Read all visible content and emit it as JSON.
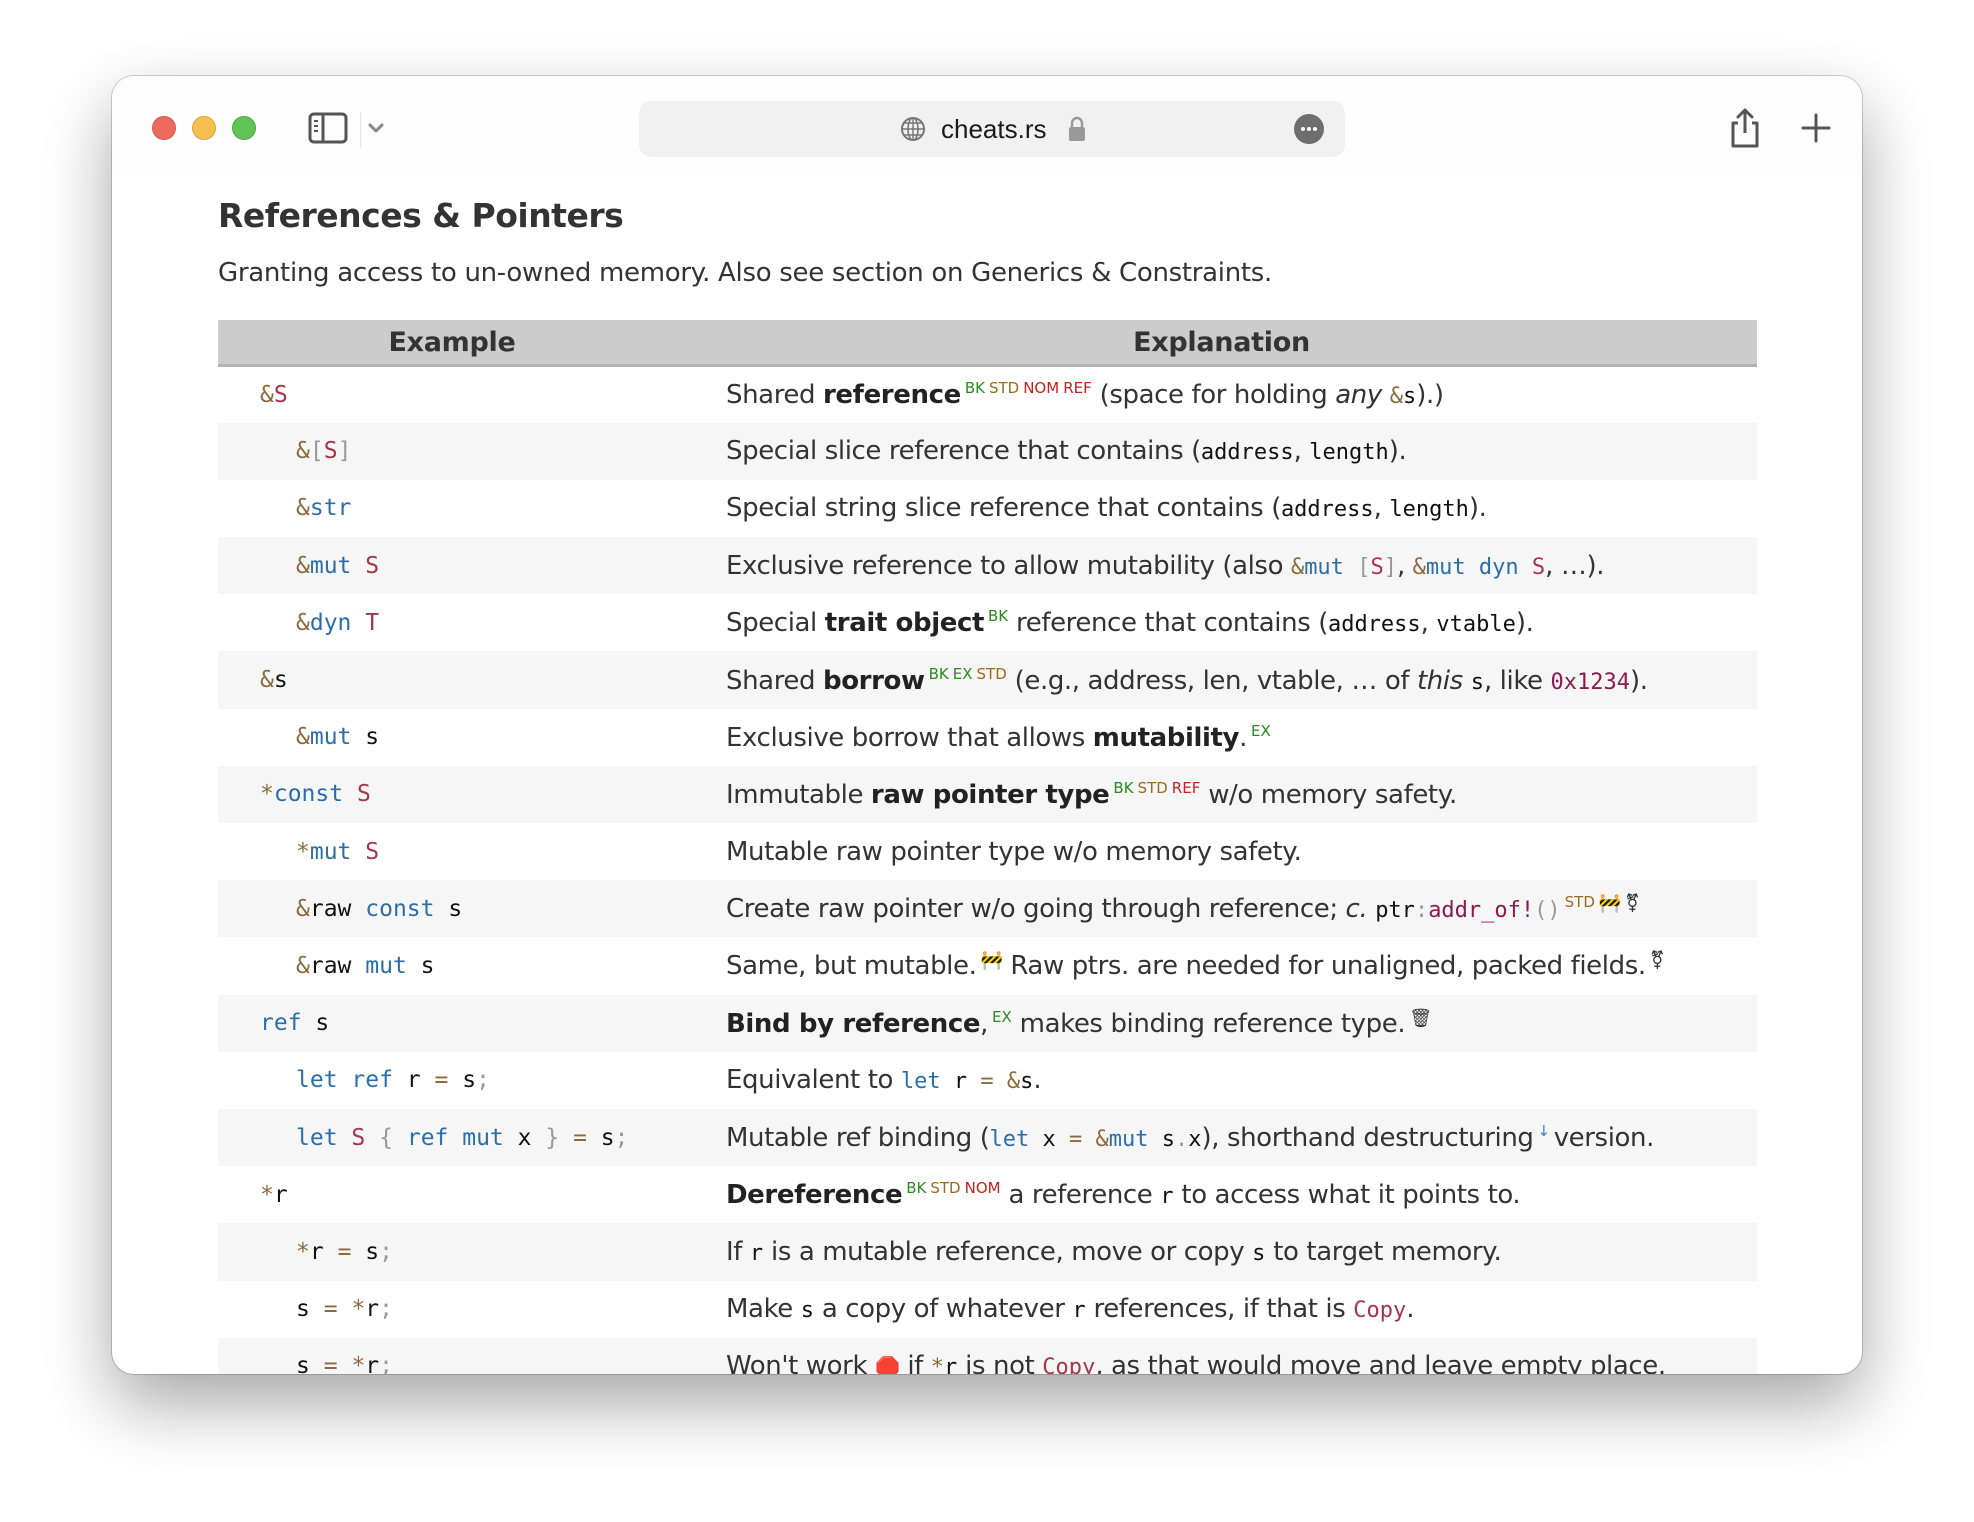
{
  "browser": {
    "url": "cheats.rs",
    "icons": {
      "close": "close-light",
      "minimize": "minimize-light",
      "zoom": "zoom-light",
      "sidebar": "sidebar-icon",
      "chevron": "chevron-down-icon",
      "globe": "globe-icon",
      "lock": "lock-icon",
      "more": "more-icon",
      "share": "share-icon",
      "new_tab": "plus-icon"
    },
    "colors": {
      "close": "#ec6a5e",
      "minimize": "#f4bf4f",
      "zoom": "#61c554"
    }
  },
  "page": {
    "title": "References & Pointers",
    "subtitle": "Granting access to un-owned memory. Also see section on Generics & Constraints."
  },
  "table": {
    "headers": {
      "example": "Example",
      "explanation": "Explanation"
    },
    "rows": [
      {
        "example": [
          [
            "amp",
            "&"
          ],
          [
            "ty",
            "S"
          ]
        ],
        "indent": 0,
        "explanation": [
          [
            "t",
            "Shared "
          ],
          [
            "b",
            "reference"
          ],
          [
            "bk",
            "BK"
          ],
          [
            "std",
            "STD"
          ],
          [
            "nom",
            "NOM"
          ],
          [
            "ref",
            "REF"
          ],
          [
            "t",
            " (space for holding "
          ],
          [
            "i",
            "any"
          ],
          [
            "t",
            " "
          ],
          [
            "c_amp",
            "&"
          ],
          [
            "c_id",
            "s"
          ],
          [
            "t",
            ").)"
          ]
        ]
      },
      {
        "example": [
          [
            "amp",
            "&"
          ],
          [
            "pu",
            "["
          ],
          [
            "ty",
            "S"
          ],
          [
            "pu",
            "]"
          ]
        ],
        "indent": 1,
        "explanation": [
          [
            "t",
            "Special slice reference that contains ("
          ],
          [
            "c_id",
            "address"
          ],
          [
            "t",
            ", "
          ],
          [
            "c_id",
            "length"
          ],
          [
            "t",
            ")."
          ]
        ]
      },
      {
        "example": [
          [
            "amp",
            "&"
          ],
          [
            "kw",
            "str"
          ]
        ],
        "indent": 1,
        "explanation": [
          [
            "t",
            "Special string slice reference that contains ("
          ],
          [
            "c_id",
            "address"
          ],
          [
            "t",
            ", "
          ],
          [
            "c_id",
            "length"
          ],
          [
            "t",
            ")."
          ]
        ]
      },
      {
        "example": [
          [
            "amp",
            "&"
          ],
          [
            "kw",
            "mut"
          ],
          [
            "sp",
            " "
          ],
          [
            "ty",
            "S"
          ]
        ],
        "indent": 1,
        "explanation": [
          [
            "t",
            "Exclusive reference to allow mutability (also "
          ],
          [
            "c_amp",
            "&"
          ],
          [
            "c_kw",
            "mut"
          ],
          [
            "c_sp",
            " "
          ],
          [
            "c_pu",
            "["
          ],
          [
            "c_ty",
            "S"
          ],
          [
            "c_pu",
            "]"
          ],
          [
            "t",
            ", "
          ],
          [
            "c_amp",
            "&"
          ],
          [
            "c_kw",
            "mut dyn"
          ],
          [
            "c_sp",
            " "
          ],
          [
            "c_ty",
            "S"
          ],
          [
            "t",
            ", …)."
          ]
        ]
      },
      {
        "example": [
          [
            "amp",
            "&"
          ],
          [
            "kw",
            "dyn"
          ],
          [
            "sp",
            " "
          ],
          [
            "ty",
            "T"
          ]
        ],
        "indent": 1,
        "explanation": [
          [
            "t",
            "Special "
          ],
          [
            "b",
            "trait object"
          ],
          [
            "bk",
            "BK"
          ],
          [
            "t",
            " reference that contains ("
          ],
          [
            "c_id",
            "address"
          ],
          [
            "t",
            ", "
          ],
          [
            "c_id",
            "vtable"
          ],
          [
            "t",
            ")."
          ]
        ]
      },
      {
        "example": [
          [
            "amp",
            "&"
          ],
          [
            "id",
            "s"
          ]
        ],
        "indent": 0,
        "explanation": [
          [
            "t",
            "Shared "
          ],
          [
            "b",
            "borrow"
          ],
          [
            "bk",
            "BK"
          ],
          [
            "ex",
            "EX"
          ],
          [
            "std",
            "STD"
          ],
          [
            "t",
            " (e.g., address, len, vtable, … of "
          ],
          [
            "i",
            "this"
          ],
          [
            "t",
            " "
          ],
          [
            "c_id",
            "s"
          ],
          [
            "t",
            ", like "
          ],
          [
            "c_num",
            "0x1234"
          ],
          [
            "t",
            ")."
          ]
        ]
      },
      {
        "example": [
          [
            "amp",
            "&"
          ],
          [
            "kw",
            "mut"
          ],
          [
            "sp",
            " "
          ],
          [
            "id",
            "s"
          ]
        ],
        "indent": 1,
        "explanation": [
          [
            "t",
            "Exclusive borrow that allows "
          ],
          [
            "b",
            "mutability"
          ],
          [
            "t",
            "."
          ],
          [
            "ex",
            "EX"
          ]
        ]
      },
      {
        "example": [
          [
            "op",
            "*"
          ],
          [
            "kw",
            "const"
          ],
          [
            "sp",
            " "
          ],
          [
            "ty",
            "S"
          ]
        ],
        "indent": 0,
        "explanation": [
          [
            "t",
            "Immutable "
          ],
          [
            "b",
            "raw pointer type"
          ],
          [
            "bk",
            "BK"
          ],
          [
            "std",
            "STD"
          ],
          [
            "ref",
            "REF"
          ],
          [
            "t",
            " w/o memory safety."
          ]
        ]
      },
      {
        "example": [
          [
            "op",
            "*"
          ],
          [
            "kw",
            "mut"
          ],
          [
            "sp",
            " "
          ],
          [
            "ty",
            "S"
          ]
        ],
        "indent": 1,
        "explanation": [
          [
            "t",
            "Mutable raw pointer type w/o memory safety."
          ]
        ]
      },
      {
        "example": [
          [
            "amp",
            "&"
          ],
          [
            "id",
            "raw"
          ],
          [
            "sp",
            " "
          ],
          [
            "kw",
            "const"
          ],
          [
            "sp",
            " "
          ],
          [
            "id",
            "s"
          ]
        ],
        "indent": 1,
        "explanation": [
          [
            "t",
            "Create raw pointer w/o going through reference; "
          ],
          [
            "i",
            "c."
          ],
          [
            "t",
            " "
          ],
          [
            "c_id",
            "ptr"
          ],
          [
            "c_pu",
            ":"
          ],
          [
            "c_mac",
            "addr_of!"
          ],
          [
            "c_pu",
            "()"
          ],
          [
            "std",
            "STD"
          ],
          [
            "emoji",
            "🚧"
          ],
          [
            "emoji2",
            "⚧"
          ]
        ]
      },
      {
        "example": [
          [
            "amp",
            "&"
          ],
          [
            "id",
            "raw"
          ],
          [
            "sp",
            " "
          ],
          [
            "kw",
            "mut"
          ],
          [
            "sp",
            " "
          ],
          [
            "id",
            "s"
          ]
        ],
        "indent": 1,
        "explanation": [
          [
            "t",
            "Same, but mutable."
          ],
          [
            "emoji",
            "🚧"
          ],
          [
            "t",
            " Raw ptrs. are needed for unaligned, packed fields."
          ],
          [
            "emoji2",
            "⚧"
          ]
        ]
      },
      {
        "example": [
          [
            "kw",
            "ref"
          ],
          [
            "sp",
            " "
          ],
          [
            "id",
            "s"
          ]
        ],
        "indent": 0,
        "explanation": [
          [
            "b",
            "Bind by reference"
          ],
          [
            "t",
            ","
          ],
          [
            "ex",
            "EX"
          ],
          [
            "t",
            " makes binding reference type."
          ],
          [
            "emoji",
            "🗑"
          ]
        ]
      },
      {
        "example": [
          [
            "kw",
            "let ref"
          ],
          [
            "sp",
            " "
          ],
          [
            "id",
            "r"
          ],
          [
            "sp",
            " "
          ],
          [
            "op",
            "="
          ],
          [
            "sp",
            " "
          ],
          [
            "id",
            "s"
          ],
          [
            "pu",
            ";"
          ]
        ],
        "indent": 1,
        "explanation": [
          [
            "t",
            "Equivalent to "
          ],
          [
            "c_kw",
            "let"
          ],
          [
            "c_sp",
            " "
          ],
          [
            "c_id",
            "r"
          ],
          [
            "c_sp",
            " "
          ],
          [
            "c_op",
            "="
          ],
          [
            "c_sp",
            " "
          ],
          [
            "c_amp",
            "&"
          ],
          [
            "c_id",
            "s"
          ],
          [
            "t",
            "."
          ]
        ]
      },
      {
        "example": [
          [
            "kw",
            "let"
          ],
          [
            "sp",
            " "
          ],
          [
            "ty",
            "S"
          ],
          [
            "sp",
            " "
          ],
          [
            "pu",
            "{"
          ],
          [
            "sp",
            " "
          ],
          [
            "kw",
            "ref mut"
          ],
          [
            "sp",
            " "
          ],
          [
            "id",
            "x"
          ],
          [
            "sp",
            " "
          ],
          [
            "pu",
            "}"
          ],
          [
            "sp",
            " "
          ],
          [
            "op",
            "="
          ],
          [
            "sp",
            " "
          ],
          [
            "id",
            "s"
          ],
          [
            "pu",
            ";"
          ]
        ],
        "indent": 1,
        "explanation": [
          [
            "t",
            "Mutable ref binding ("
          ],
          [
            "c_kw",
            "let"
          ],
          [
            "c_sp",
            " "
          ],
          [
            "c_id",
            "x"
          ],
          [
            "c_sp",
            " "
          ],
          [
            "c_op",
            "="
          ],
          [
            "c_sp",
            " "
          ],
          [
            "c_amp",
            "&"
          ],
          [
            "c_kw",
            "mut"
          ],
          [
            "c_sp",
            " "
          ],
          [
            "c_id",
            "s"
          ],
          [
            "c_pu",
            "."
          ],
          [
            "c_id",
            "x"
          ],
          [
            "t",
            "), shorthand destructuring"
          ],
          [
            "down",
            "↓"
          ],
          [
            "t",
            "version."
          ]
        ]
      },
      {
        "example": [
          [
            "op",
            "*"
          ],
          [
            "id",
            "r"
          ]
        ],
        "indent": 0,
        "explanation": [
          [
            "b",
            "Dereference"
          ],
          [
            "bk",
            "BK"
          ],
          [
            "std",
            "STD"
          ],
          [
            "nom",
            "NOM"
          ],
          [
            "t",
            " a reference "
          ],
          [
            "c_id",
            "r"
          ],
          [
            "t",
            " to access what it points to."
          ]
        ]
      },
      {
        "example": [
          [
            "op",
            "*"
          ],
          [
            "id",
            "r"
          ],
          [
            "sp",
            " "
          ],
          [
            "op",
            "="
          ],
          [
            "sp",
            " "
          ],
          [
            "id",
            "s"
          ],
          [
            "pu",
            ";"
          ]
        ],
        "indent": 1,
        "explanation": [
          [
            "t",
            "If "
          ],
          [
            "c_id",
            "r"
          ],
          [
            "t",
            " is a mutable reference, move or copy "
          ],
          [
            "c_id",
            "s"
          ],
          [
            "t",
            " to target memory."
          ]
        ]
      },
      {
        "example": [
          [
            "id",
            "s"
          ],
          [
            "sp",
            " "
          ],
          [
            "op",
            "="
          ],
          [
            "sp",
            " "
          ],
          [
            "op",
            "*"
          ],
          [
            "id",
            "r"
          ],
          [
            "pu",
            ";"
          ]
        ],
        "indent": 1,
        "explanation": [
          [
            "t",
            "Make "
          ],
          [
            "c_id",
            "s"
          ],
          [
            "t",
            " a copy of whatever "
          ],
          [
            "c_id",
            "r"
          ],
          [
            "t",
            " references, if that is "
          ],
          [
            "c_cp",
            "Copy"
          ],
          [
            "t",
            "."
          ]
        ]
      },
      {
        "example": [
          [
            "id",
            "s"
          ],
          [
            "sp",
            " "
          ],
          [
            "op",
            "="
          ],
          [
            "sp",
            " "
          ],
          [
            "op",
            "*"
          ],
          [
            "id",
            "r"
          ],
          [
            "pu",
            ";"
          ]
        ],
        "indent": 1,
        "explanation": [
          [
            "t",
            "Won't work "
          ],
          [
            "stop",
            "🛑"
          ],
          [
            "t",
            " if "
          ],
          [
            "c_op",
            "*"
          ],
          [
            "c_id",
            "r"
          ],
          [
            "t",
            " is not "
          ],
          [
            "c_cp",
            "Copy"
          ],
          [
            "t",
            ", as that would move and leave empty place."
          ]
        ]
      }
    ]
  }
}
